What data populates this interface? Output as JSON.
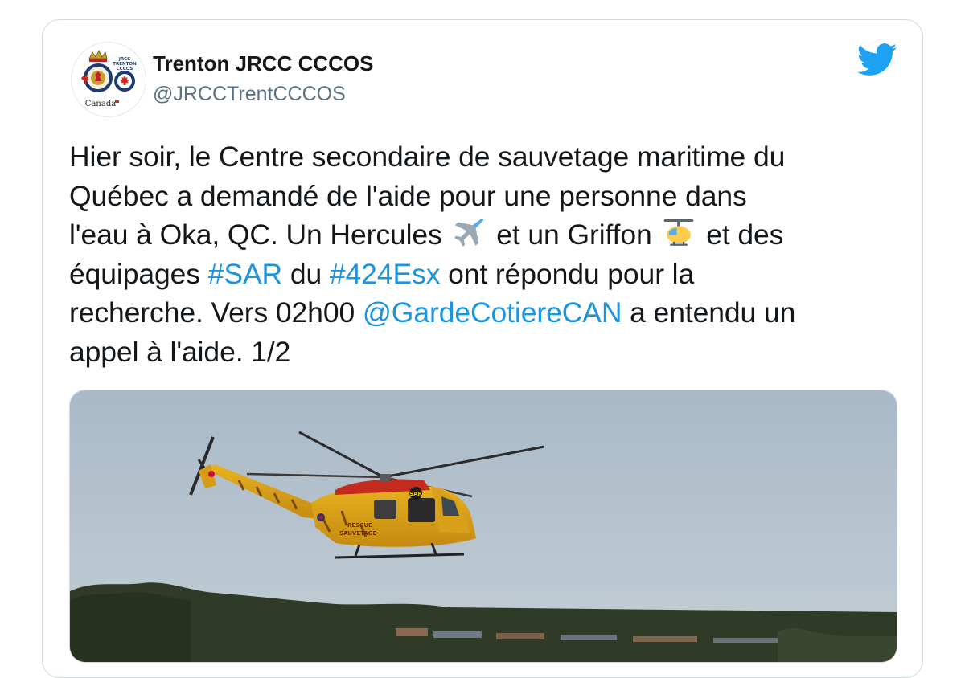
{
  "account": {
    "display_name": "Trenton JRCC CCCOS",
    "handle": "@JRCCTrentCCCOS",
    "avatar_icon": "jrcc-crest-icon",
    "avatar_text": [
      "JRCC",
      "TRENTON",
      "CCCOS",
      "Canada"
    ]
  },
  "brand": {
    "icon": "twitter-bird-icon",
    "color": "#1da1f2"
  },
  "tweet": {
    "line1": "Hier soir, le Centre secondaire de sauvetage maritime du",
    "line2": "Québec a demandé de l'aide pour une personne dans",
    "line3_a": "l'eau à Oka, QC. Un Hercules",
    "line3_emoji1": "airplane-emoji",
    "line3_b": "et un Griffon",
    "line3_emoji2": "helicopter-emoji",
    "line3_c": "et des",
    "line4_a": "équipages",
    "hashtag1": "#SAR",
    "line4_b": "du",
    "hashtag2": "#424Esx",
    "line4_c": "ont répondu pour la",
    "line5_a": "recherche. Vers 02h00",
    "mention": "@GardeCotiereCAN",
    "line5_b": "a entendu un",
    "line6": "appel à l'aide. 1/2",
    "link_color": "#1b95e0"
  },
  "media": {
    "subject": "yellow-search-and-rescue-helicopter",
    "helicopter_markings": [
      "SAR",
      "RESCUE",
      "SAUVETAGE"
    ]
  }
}
